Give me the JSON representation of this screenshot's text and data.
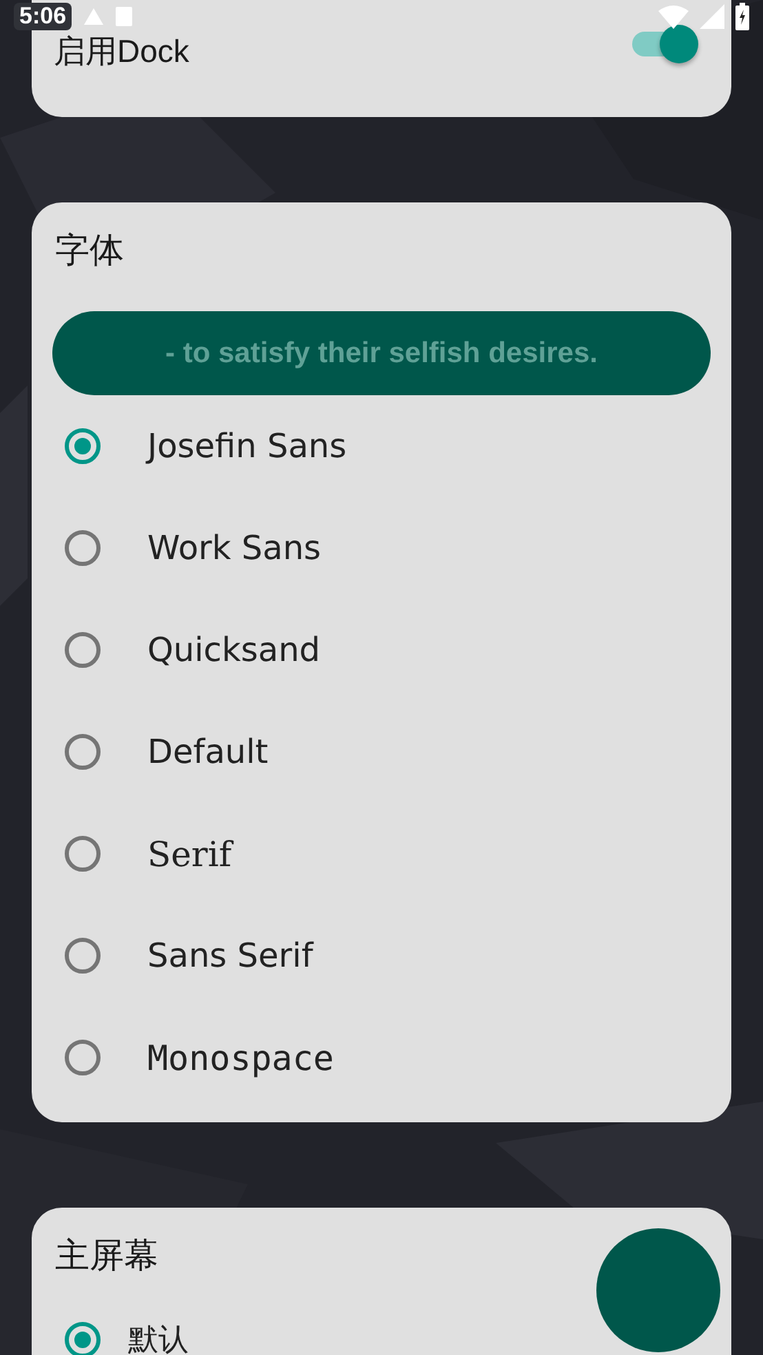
{
  "status_bar": {
    "time": "5:06"
  },
  "dock_card": {
    "label": "启用Dock",
    "toggle_on": true
  },
  "font_card": {
    "title": "字体",
    "preview": "- to satisfy their selfish desires.",
    "options": [
      {
        "label": "Josefin Sans",
        "kind": "sans",
        "selected": true
      },
      {
        "label": "Work Sans",
        "kind": "sans",
        "selected": false
      },
      {
        "label": "Quicksand",
        "kind": "sans",
        "selected": false
      },
      {
        "label": "Default",
        "kind": "sans",
        "selected": false
      },
      {
        "label": "Serif",
        "kind": "serif",
        "selected": false
      },
      {
        "label": "Sans Serif",
        "kind": "sans",
        "selected": false
      },
      {
        "label": "Monospace",
        "kind": "mono",
        "selected": false
      }
    ]
  },
  "home_card": {
    "title": "主屏幕",
    "options": [
      {
        "label": "默认",
        "selected": true
      }
    ]
  }
}
